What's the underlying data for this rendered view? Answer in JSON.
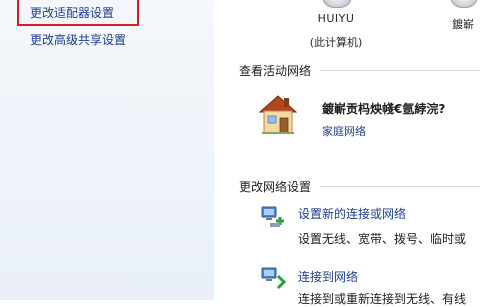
{
  "sidebar": {
    "links": [
      "更改适配器设置",
      "更改高级共享设置"
    ]
  },
  "network_map": {
    "computer_name": "HUIYU",
    "computer_sub": "(此计算机)",
    "right_node_label": "鍍嶄"
  },
  "active_networks": {
    "header": "查看活动网络",
    "network_name": "鍍嶄贡杩炴帴€氬綍浣?",
    "network_type": "家庭网络",
    "icon": "house-icon"
  },
  "change_settings": {
    "header": "更改网络设置",
    "tasks": [
      {
        "label": "设置新的连接或网络",
        "desc": "设置无线、宽带、拨号、临时或",
        "icon": "network-setup-icon"
      },
      {
        "label": "连接到网络",
        "desc": "连接到或重新连接到无线、有线",
        "icon": "network-connect-icon"
      }
    ]
  },
  "colors": {
    "link": "#1e3f8f",
    "highlight": "#d71f1f",
    "sidebar_bg": "#eef3f9"
  }
}
